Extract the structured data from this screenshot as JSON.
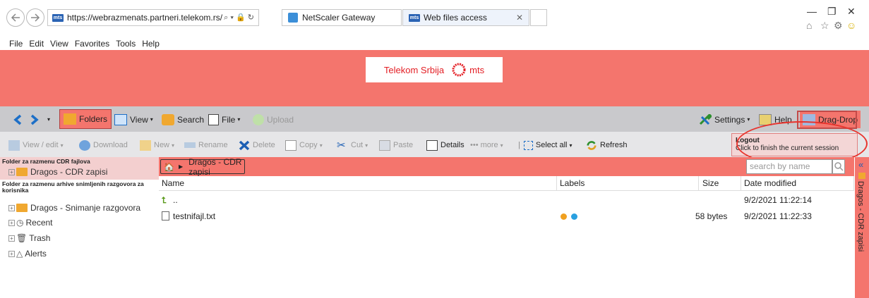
{
  "browser": {
    "url": "https://webrazmenats.partneri.telekom.rs/",
    "tabs": [
      {
        "label": "NetScaler Gateway"
      },
      {
        "label": "Web files access"
      }
    ],
    "menu": [
      "File",
      "Edit",
      "View",
      "Favorites",
      "Tools",
      "Help"
    ]
  },
  "header": {
    "brand": "Telekom Srbija",
    "brand2": "mts"
  },
  "toolbar1": {
    "folders": "Folders",
    "view": "View",
    "search": "Search",
    "file": "File",
    "upload": "Upload",
    "settings": "Settings",
    "help": "Help",
    "dragdrop": "Drag-Drop"
  },
  "toolbar2": {
    "view_edit": "View / edit",
    "download": "Download",
    "new": "New",
    "rename": "Rename",
    "delete": "Delete",
    "copy": "Copy",
    "cut": "Cut",
    "paste": "Paste",
    "details": "Details",
    "more": "••• more",
    "select_all": "Select all",
    "refresh": "Refresh"
  },
  "logout": {
    "title": "Logout",
    "desc": "Click to finish the current session"
  },
  "tree": {
    "section1": "Folder za razmenu CDR fajlova",
    "item1": "Dragos - CDR zapisi",
    "section2": "Folder za razmenu arhive snimljenih razgovora za korisnika",
    "item2": "Dragos - Snimanje razgovora",
    "recent": "Recent",
    "trash": "Trash",
    "alerts": "Alerts"
  },
  "breadcrumb": "Dragos - CDR zapisi",
  "search_placeholder": "search by name",
  "table": {
    "headers": {
      "name": "Name",
      "labels": "Labels",
      "size": "Size",
      "date": "Date modified"
    },
    "rows": [
      {
        "name": "..",
        "size": "",
        "date": "9/2/2021 11:22:14"
      },
      {
        "name": "testnifajl.txt",
        "size": "58 bytes",
        "date": "9/2/2021 11:22:33"
      }
    ]
  },
  "right_pane": "Dragos - CDR zapisi",
  "colors": {
    "brand_red": "#f4756d",
    "label_orange": "#f0a020",
    "label_blue": "#2aa0e0"
  }
}
